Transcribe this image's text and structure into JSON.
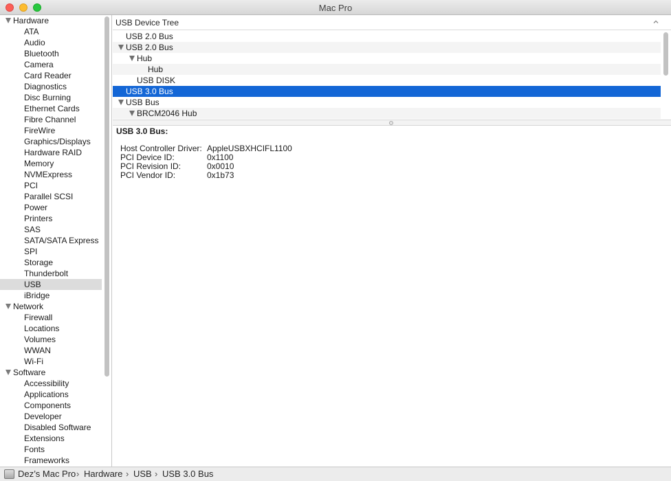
{
  "window": {
    "title": "Mac Pro"
  },
  "sidebar": {
    "rows": [
      {
        "label": "Hardware",
        "kind": "section",
        "selected": false
      },
      {
        "label": "ATA",
        "kind": "item",
        "selected": false
      },
      {
        "label": "Audio",
        "kind": "item",
        "selected": false
      },
      {
        "label": "Bluetooth",
        "kind": "item",
        "selected": false
      },
      {
        "label": "Camera",
        "kind": "item",
        "selected": false
      },
      {
        "label": "Card Reader",
        "kind": "item",
        "selected": false
      },
      {
        "label": "Diagnostics",
        "kind": "item",
        "selected": false
      },
      {
        "label": "Disc Burning",
        "kind": "item",
        "selected": false
      },
      {
        "label": "Ethernet Cards",
        "kind": "item",
        "selected": false
      },
      {
        "label": "Fibre Channel",
        "kind": "item",
        "selected": false
      },
      {
        "label": "FireWire",
        "kind": "item",
        "selected": false
      },
      {
        "label": "Graphics/Displays",
        "kind": "item",
        "selected": false
      },
      {
        "label": "Hardware RAID",
        "kind": "item",
        "selected": false
      },
      {
        "label": "Memory",
        "kind": "item",
        "selected": false
      },
      {
        "label": "NVMExpress",
        "kind": "item",
        "selected": false
      },
      {
        "label": "PCI",
        "kind": "item",
        "selected": false
      },
      {
        "label": "Parallel SCSI",
        "kind": "item",
        "selected": false
      },
      {
        "label": "Power",
        "kind": "item",
        "selected": false
      },
      {
        "label": "Printers",
        "kind": "item",
        "selected": false
      },
      {
        "label": "SAS",
        "kind": "item",
        "selected": false
      },
      {
        "label": "SATA/SATA Express",
        "kind": "item",
        "selected": false
      },
      {
        "label": "SPI",
        "kind": "item",
        "selected": false
      },
      {
        "label": "Storage",
        "kind": "item",
        "selected": false
      },
      {
        "label": "Thunderbolt",
        "kind": "item",
        "selected": false
      },
      {
        "label": "USB",
        "kind": "item",
        "selected": true
      },
      {
        "label": "iBridge",
        "kind": "item",
        "selected": false
      },
      {
        "label": "Network",
        "kind": "section",
        "selected": false
      },
      {
        "label": "Firewall",
        "kind": "item",
        "selected": false
      },
      {
        "label": "Locations",
        "kind": "item",
        "selected": false
      },
      {
        "label": "Volumes",
        "kind": "item",
        "selected": false
      },
      {
        "label": "WWAN",
        "kind": "item",
        "selected": false
      },
      {
        "label": "Wi-Fi",
        "kind": "item",
        "selected": false
      },
      {
        "label": "Software",
        "kind": "section",
        "selected": false
      },
      {
        "label": "Accessibility",
        "kind": "item",
        "selected": false
      },
      {
        "label": "Applications",
        "kind": "item",
        "selected": false
      },
      {
        "label": "Components",
        "kind": "item",
        "selected": false
      },
      {
        "label": "Developer",
        "kind": "item",
        "selected": false
      },
      {
        "label": "Disabled Software",
        "kind": "item",
        "selected": false
      },
      {
        "label": "Extensions",
        "kind": "item",
        "selected": false
      },
      {
        "label": "Fonts",
        "kind": "item",
        "selected": false
      },
      {
        "label": "Frameworks",
        "kind": "item",
        "selected": false
      }
    ]
  },
  "tree": {
    "header": "USB Device Tree",
    "rows": [
      {
        "label": "USB 2.0 Bus",
        "level": 0,
        "expanded": false,
        "selected": false
      },
      {
        "label": "USB 2.0 Bus",
        "level": 0,
        "expanded": true,
        "selected": false
      },
      {
        "label": "Hub",
        "level": 1,
        "expanded": true,
        "selected": false
      },
      {
        "label": "Hub",
        "level": 2,
        "expanded": false,
        "selected": false
      },
      {
        "label": "USB DISK",
        "level": 1,
        "expanded": false,
        "selected": false
      },
      {
        "label": "USB 3.0 Bus",
        "level": 0,
        "expanded": false,
        "selected": true
      },
      {
        "label": "USB Bus",
        "level": 0,
        "expanded": true,
        "selected": false
      },
      {
        "label": "BRCM2046 Hub",
        "level": 1,
        "expanded": true,
        "selected": false
      }
    ]
  },
  "detail": {
    "title": "USB 3.0 Bus:",
    "properties": [
      {
        "key": "Host Controller Driver:",
        "value": "AppleUSBXHCIFL1100"
      },
      {
        "key": "PCI Device ID:",
        "value": "0x1100"
      },
      {
        "key": "PCI Revision ID:",
        "value": "0x0010"
      },
      {
        "key": "PCI Vendor ID:",
        "value": "0x1b73"
      }
    ]
  },
  "pathbar": {
    "items": [
      "Dez’s Mac Pro",
      "Hardware",
      "USB",
      "USB 3.0 Bus"
    ],
    "separator": "›"
  },
  "colors": {
    "selection_blue": "#1366d6",
    "sidebar_selection": "#dcdcdc"
  }
}
